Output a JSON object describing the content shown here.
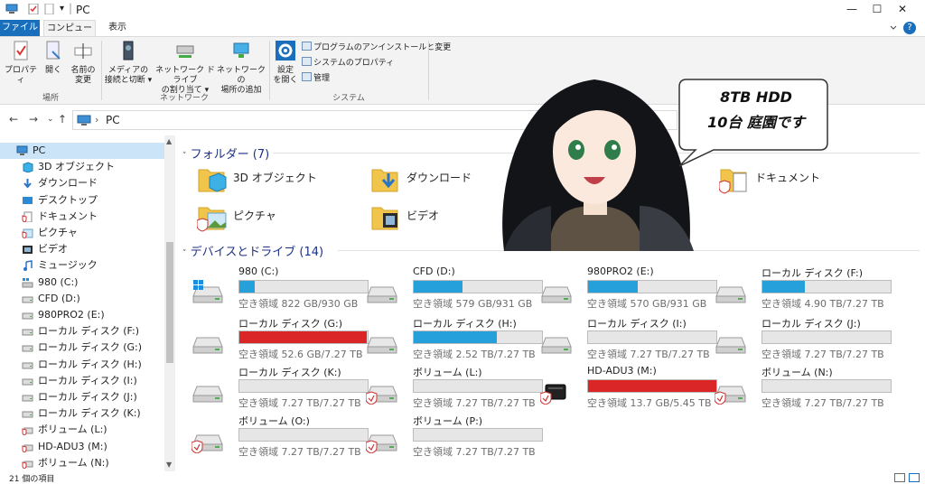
{
  "window": {
    "title": "PC",
    "minimize": "—",
    "maximize": "☐",
    "close": "✕",
    "quick_access_dropdown": "▾"
  },
  "ribbon": {
    "tabs": [
      "ファイル",
      "コンピューター",
      "表示"
    ],
    "help": "?",
    "location_group": {
      "label": "場所",
      "buttons": [
        {
          "line1": "プロパティ",
          "line2": ""
        },
        {
          "line1": "開く",
          "line2": ""
        },
        {
          "line1": "名前の",
          "line2": "変更"
        }
      ]
    },
    "network_group": {
      "label": "ネットワーク",
      "buttons": [
        {
          "line1": "メディアの",
          "line2": "接続と切断 ▾"
        },
        {
          "line1": "ネットワーク ドライブ",
          "line2": "の割り当て ▾"
        },
        {
          "line1": "ネットワークの",
          "line2": "場所の追加"
        }
      ]
    },
    "system_group": {
      "label": "システム",
      "settings": {
        "line1": "設定",
        "line2": "を開く"
      },
      "commands": [
        "プログラムのアンインストールと変更",
        "システムのプロパティ",
        "管理"
      ]
    }
  },
  "address": {
    "back": "←",
    "forward": "→",
    "recent": "⌄",
    "up": "↑",
    "separator": "›",
    "path": "PC"
  },
  "nav_pane": {
    "items": [
      {
        "label": "PC",
        "icon": "pc-icon"
      },
      {
        "label": "3D オブジェクト",
        "icon": "3d-objects-icon"
      },
      {
        "label": "ダウンロード",
        "icon": "download-icon"
      },
      {
        "label": "デスクトップ",
        "icon": "desktop-icon"
      },
      {
        "label": "ドキュメント",
        "icon": "documents-icon"
      },
      {
        "label": "ピクチャ",
        "icon": "pictures-icon"
      },
      {
        "label": "ビデオ",
        "icon": "videos-icon"
      },
      {
        "label": "ミュージック",
        "icon": "music-icon"
      },
      {
        "label": "980 (C:)",
        "icon": "windows-drive-icon"
      },
      {
        "label": "CFD (D:)",
        "icon": "drive-icon"
      },
      {
        "label": "980PRO2 (E:)",
        "icon": "drive-icon"
      },
      {
        "label": "ローカル ディスク (F:)",
        "icon": "drive-icon"
      },
      {
        "label": "ローカル ディスク (G:)",
        "icon": "drive-icon"
      },
      {
        "label": "ローカル ディスク (H:)",
        "icon": "drive-icon"
      },
      {
        "label": "ローカル ディスク (I:)",
        "icon": "drive-icon"
      },
      {
        "label": "ローカル ディスク (J:)",
        "icon": "drive-icon"
      },
      {
        "label": "ローカル ディスク (K:)",
        "icon": "drive-icon"
      },
      {
        "label": "ボリューム (L:)",
        "icon": "protected-drive-icon"
      },
      {
        "label": "HD-ADU3 (M:)",
        "icon": "protected-drive-icon"
      },
      {
        "label": "ボリューム (N:)",
        "icon": "protected-drive-icon"
      }
    ],
    "scroll_up": "▲",
    "scroll_down": "▼"
  },
  "folders_section": {
    "header": "フォルダー (7)",
    "items": [
      {
        "label": "3D オブジェクト",
        "icon": "3d-objects-folder-icon"
      },
      {
        "label": "ダウンロード",
        "icon": "downloads-folder-icon"
      },
      {
        "label": "ドキュメント",
        "icon": "documents-folder-icon"
      },
      {
        "label": "ピクチャ",
        "icon": "pictures-folder-icon"
      },
      {
        "label": "ビデオ",
        "icon": "videos-folder-icon"
      }
    ]
  },
  "drives_section": {
    "header": "デバイスとドライブ (14)",
    "drives": [
      {
        "name": "980 (C:)",
        "free": "空き領域 822 GB/930 GB",
        "used_fraction": 0.12,
        "color": "blue",
        "icon": "windows-drive-icon"
      },
      {
        "name": "CFD (D:)",
        "free": "空き領域 579 GB/931 GB",
        "used_fraction": 0.38,
        "color": "blue",
        "icon": "drive-icon"
      },
      {
        "name": "980PRO2 (E:)",
        "free": "空き領域 570 GB/931 GB",
        "used_fraction": 0.39,
        "color": "blue",
        "icon": "drive-icon"
      },
      {
        "name": "ローカル ディスク (F:)",
        "free": "空き領域 4.90 TB/7.27 TB",
        "used_fraction": 0.33,
        "color": "blue",
        "icon": "drive-icon"
      },
      {
        "name": "ローカル ディスク (G:)",
        "free": "空き領域 52.6 GB/7.27 TB",
        "used_fraction": 0.99,
        "color": "red",
        "icon": "drive-icon"
      },
      {
        "name": "ローカル ディスク (H:)",
        "free": "空き領域 2.52 TB/7.27 TB",
        "used_fraction": 0.65,
        "color": "blue",
        "icon": "drive-icon"
      },
      {
        "name": "ローカル ディスク (I:)",
        "free": "空き領域 7.27 TB/7.27 TB",
        "used_fraction": 0.0,
        "color": "blue",
        "icon": "drive-icon"
      },
      {
        "name": "ローカル ディスク (J:)",
        "free": "空き領域 7.27 TB/7.27 TB",
        "used_fraction": 0.0,
        "color": "blue",
        "icon": "drive-icon"
      },
      {
        "name": "ローカル ディスク (K:)",
        "free": "空き領域 7.27 TB/7.27 TB",
        "used_fraction": 0.0,
        "color": "blue",
        "icon": "drive-icon"
      },
      {
        "name": "ボリューム (L:)",
        "free": "空き領域 7.27 TB/7.27 TB",
        "used_fraction": 0.0,
        "color": "blue",
        "icon": "protected-drive-icon"
      },
      {
        "name": "HD-ADU3 (M:)",
        "free": "空き領域 13.7 GB/5.45 TB",
        "used_fraction": 0.998,
        "color": "red",
        "icon": "external-drive-icon"
      },
      {
        "name": "ボリューム (N:)",
        "free": "空き領域 7.27 TB/7.27 TB",
        "used_fraction": 0.0,
        "color": "blue",
        "icon": "protected-drive-icon"
      },
      {
        "name": "ボリューム (O:)",
        "free": "空き領域 7.27 TB/7.27 TB",
        "used_fraction": 0.0,
        "color": "blue",
        "icon": "protected-drive-icon"
      },
      {
        "name": "ボリューム (P:)",
        "free": "空き領域 7.27 TB/7.27 TB",
        "used_fraction": 0.0,
        "color": "blue",
        "icon": "protected-drive-icon"
      }
    ]
  },
  "status_bar": {
    "item_count": "21 個の項目"
  },
  "overlay": {
    "speech_line1": "8TB HDD",
    "speech_line2": "10台 庭園です"
  },
  "colors": {
    "accent": "#1a6fbd",
    "bar_normal": "#26a0da",
    "bar_full": "#da2626",
    "section_header": "#1e3287"
  }
}
